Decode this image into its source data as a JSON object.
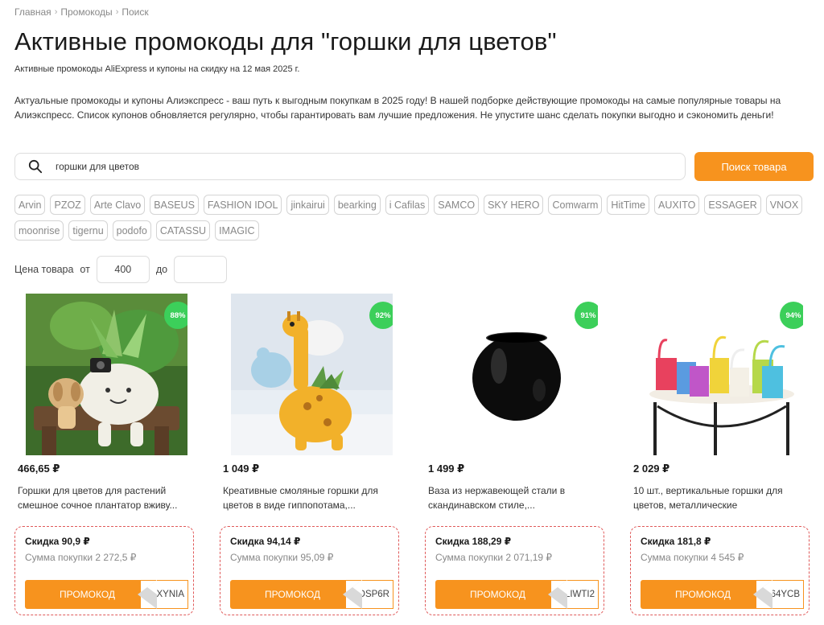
{
  "breadcrumbs": [
    "Главная",
    "Промокоды",
    "Поиск"
  ],
  "heading": "Активные промокоды для \"горшки для цветов\"",
  "subtitle": "Активные промокоды AliExpress и купоны на скидку на 12 мая 2025 г.",
  "description": "Актуальные промокоды и купоны Алиэкспресс - ваш путь к выгодным покупкам в 2025 году! В нашей подборке действующие промокоды на самые популярные товары на Алиэкспресс. Список купонов обновляется регулярно, чтобы гарантировать вам лучшие предложения. Не упустите шанс сделать покупки выгодно и сэкономить деньги!",
  "search": {
    "value": "горшки для цветов",
    "button": "Поиск товара"
  },
  "brands": [
    "Arvin",
    "PZOZ",
    "Arte Clavo",
    "BASEUS",
    "FASHION IDOL",
    "jinkairui",
    "bearking",
    "i Cafilas",
    "SAMCO",
    "SKY HERO",
    "Comwarm",
    "HitTime",
    "AUXITO",
    "ESSAGER",
    "VNOX",
    "moonrise",
    "tigernu",
    "podofo",
    "CATASSU",
    "IMAGIC"
  ],
  "price_filter": {
    "label": "Цена товара",
    "from_label": "от",
    "from_value": "400",
    "to_label": "до",
    "to_value": ""
  },
  "products": [
    {
      "badge": "88%",
      "price": "466,65 ₽",
      "title": "Горшки для цветов для растений смешное сочное плантатор вживу...",
      "discount": "Скидка 90,9 ₽",
      "sum": "Сумма покупки 2 272,5 ₽",
      "promo_label": "ПРОМОКОД",
      "code": "1XYNIA"
    },
    {
      "badge": "92%",
      "price": "1 049 ₽",
      "title": "Креативные смоляные горшки для цветов в виде гиппопотама,...",
      "discount": "Скидка 94,14 ₽",
      "sum": "Сумма покупки 95,09 ₽",
      "promo_label": "ПРОМОКОД",
      "code": "OSP6R"
    },
    {
      "badge": "91%",
      "price": "1 499 ₽",
      "title": "Ваза из нержавеющей стали в скандинавском стиле,...",
      "discount": "Скидка 188,29 ₽",
      "sum": "Сумма покупки 2 071,19 ₽",
      "promo_label": "ПРОМОКОД",
      "code": "LIWTI2"
    },
    {
      "badge": "94%",
      "price": "2 029 ₽",
      "title": "10 шт., вертикальные горшки для цветов, металлические",
      "discount": "Скидка 181,8 ₽",
      "sum": "Сумма покупки 4 545 ₽",
      "promo_label": "ПРОМОКОД",
      "code": "64YCB"
    }
  ],
  "colors": {
    "accent": "#f7931e",
    "badge": "#3ccf5a",
    "promo_border": "#e05a5a"
  }
}
